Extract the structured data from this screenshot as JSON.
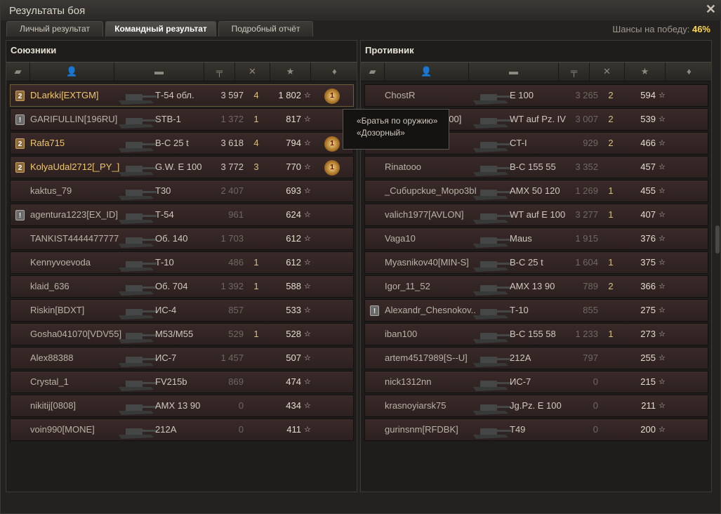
{
  "window": {
    "title": "Результаты боя",
    "close_icon": "close-icon"
  },
  "tabs": [
    {
      "label": "Личный результат"
    },
    {
      "label": "Командный результат"
    },
    {
      "label": "Подробный отчёт"
    }
  ],
  "chance": {
    "label": "Шансы на победу:",
    "value": "46%"
  },
  "allies": {
    "title": "Союзники",
    "rows": [
      {
        "badge": "gold",
        "name": "DLarkki[EXTGM]",
        "name_color": "gold",
        "vehicle": "Т-54 обл.",
        "damage": "3 597",
        "frags": "4",
        "xp": "1 802",
        "medal": true,
        "hl": true
      },
      {
        "badge": "grey",
        "name": "GARIFULLIN[196RU]",
        "vehicle": "STB-1",
        "damage": "1 372",
        "frags": "1",
        "xp": "817",
        "dim": true
      },
      {
        "badge": "gold",
        "name": "Rafa715",
        "name_color": "gold",
        "vehicle": "B-C 25 t",
        "damage": "3 618",
        "frags": "4",
        "xp": "794",
        "medal": true
      },
      {
        "badge": "gold",
        "name": "KolyaUdal2712[_PY_]",
        "name_color": "gold",
        "vehicle": "G.W. E 100",
        "damage": "3 772",
        "frags": "3",
        "xp": "770",
        "medal": true
      },
      {
        "name": "kaktus_79",
        "vehicle": "T30",
        "damage": "2 407",
        "frags": "",
        "xp": "693",
        "dim": true
      },
      {
        "badge": "grey",
        "name": "agentura1223[EX_ID]",
        "vehicle": "Т-54",
        "damage": "961",
        "frags": "",
        "xp": "624",
        "dim": true
      },
      {
        "name": "TANKIST4444477777",
        "vehicle": "Об. 140",
        "damage": "1 703",
        "frags": "",
        "xp": "612",
        "dim": true
      },
      {
        "name": "Kennyvoevoda",
        "vehicle": "Т-10",
        "damage": "486",
        "frags": "1",
        "xp": "612",
        "dim": true
      },
      {
        "name": "klaid_636",
        "vehicle": "Об. 704",
        "damage": "1 392",
        "frags": "1",
        "xp": "588",
        "dim": true
      },
      {
        "name": "Riskin[BDXT]",
        "vehicle": "ИС-4",
        "damage": "857",
        "frags": "",
        "xp": "533",
        "dim": true
      },
      {
        "name": "Gosha041070[VDV55]",
        "vehicle": "M53/M55",
        "damage": "529",
        "frags": "1",
        "xp": "528",
        "dim": true
      },
      {
        "name": "Alex88388",
        "vehicle": "ИС-7",
        "damage": "1 457",
        "frags": "",
        "xp": "507",
        "dim": true
      },
      {
        "name": "Crystal_1",
        "vehicle": "FV215b",
        "damage": "869",
        "frags": "",
        "xp": "474",
        "dim": true
      },
      {
        "name": "nikitij[0808]",
        "vehicle": "AMX 13 90",
        "damage": "0",
        "frags": "",
        "xp": "434",
        "dim": true
      },
      {
        "name": "voin990[MONE]",
        "vehicle": "212A",
        "damage": "0",
        "frags": "",
        "xp": "411",
        "dim": true
      }
    ]
  },
  "enemies": {
    "title": "Противник",
    "rows": [
      {
        "name": "ChostR",
        "vehicle": "E 100",
        "damage": "3 265",
        "frags": "2",
        "xp": "594",
        "dim": true
      },
      {
        "name": "",
        "vehicle": "WT auf Pz. IV",
        "damage": "3 007",
        "frags": "2",
        "xp": "539",
        "dim": true,
        "partial": "100]"
      },
      {
        "name": "",
        "vehicle": "CT-I",
        "damage": "929",
        "frags": "2",
        "xp": "466",
        "dim": true
      },
      {
        "name": "Rinatooo",
        "vehicle": "B-C 155 55",
        "damage": "3 352",
        "frags": "",
        "xp": "457",
        "dim": true
      },
      {
        "name": "_Cuбupckue_Mopo3bI",
        "vehicle": "AMX 50 120",
        "damage": "1 269",
        "frags": "1",
        "xp": "455",
        "dim": true
      },
      {
        "name": "valich1977[AVLON]",
        "vehicle": "WT auf E 100",
        "damage": "3 277",
        "frags": "1",
        "xp": "407",
        "dim": true
      },
      {
        "name": "Vaga10",
        "vehicle": "Maus",
        "damage": "1 915",
        "frags": "",
        "xp": "376",
        "dim": true
      },
      {
        "name": "Myasnikov40[MIN-S]",
        "vehicle": "B-C 25 t",
        "damage": "1 604",
        "frags": "1",
        "xp": "375",
        "dim": true
      },
      {
        "name": "Igor_11_52",
        "vehicle": "AMX 13 90",
        "damage": "789",
        "frags": "2",
        "xp": "366",
        "dim": true
      },
      {
        "badge": "grey",
        "name": "Alexandr_Chesnokov..",
        "vehicle": "Т-10",
        "damage": "855",
        "frags": "",
        "xp": "275",
        "dim": true
      },
      {
        "name": "iban100",
        "vehicle": "B-C 155 58",
        "damage": "1 233",
        "frags": "1",
        "xp": "273",
        "dim": true
      },
      {
        "name": "artem4517989[S--U]",
        "vehicle": "212A",
        "damage": "797",
        "frags": "",
        "xp": "255",
        "dim": true
      },
      {
        "name": "nick1312nn",
        "vehicle": "ИС-7",
        "damage": "0",
        "frags": "",
        "xp": "215",
        "dim": true
      },
      {
        "name": "krasnoyiarsk75",
        "vehicle": "Jg.Pz. E 100",
        "damage": "0",
        "frags": "",
        "xp": "211",
        "dim": true
      },
      {
        "name": "gurinsnm[RFDBK]",
        "vehicle": "T49",
        "damage": "0",
        "frags": "",
        "xp": "200",
        "dim": true
      }
    ]
  },
  "tooltip": {
    "line1": "«Братья по оружию»",
    "line2": "«Дозорный»"
  },
  "star": "☆"
}
